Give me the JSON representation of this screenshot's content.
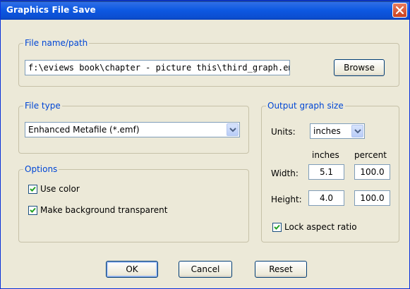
{
  "window": {
    "title": "Graphics File Save"
  },
  "file_group": {
    "legend": "File name/path",
    "path_value": "f:\\eviews book\\chapter - picture this\\third_graph.emf",
    "browse_label": "Browse"
  },
  "filetype_group": {
    "legend": "File type",
    "selected": "Enhanced Metafile (*.emf)"
  },
  "options_group": {
    "legend": "Options",
    "use_color_label": "Use color",
    "use_color_checked": true,
    "transparent_label": "Make background transparent",
    "transparent_checked": true
  },
  "size_group": {
    "legend": "Output graph size",
    "units_label": "Units:",
    "units_value": "inches",
    "col_inches": "inches",
    "col_percent": "percent",
    "width_label": "Width:",
    "width_inches": "5.1",
    "width_percent": "100.0",
    "height_label": "Height:",
    "height_inches": "4.0",
    "height_percent": "100.0",
    "lock_label": "Lock aspect ratio",
    "lock_checked": true
  },
  "buttons": {
    "ok": "OK",
    "cancel": "Cancel",
    "reset": "Reset"
  },
  "colors": {
    "title_bar": "#0d58e2",
    "legend_text": "#0046d5",
    "dialog_bg": "#ece9d8",
    "close_button": "#e05b32"
  },
  "icons": {
    "close": "close-icon",
    "dropdown": "chevron-down-icon",
    "check": "checkmark-icon"
  }
}
